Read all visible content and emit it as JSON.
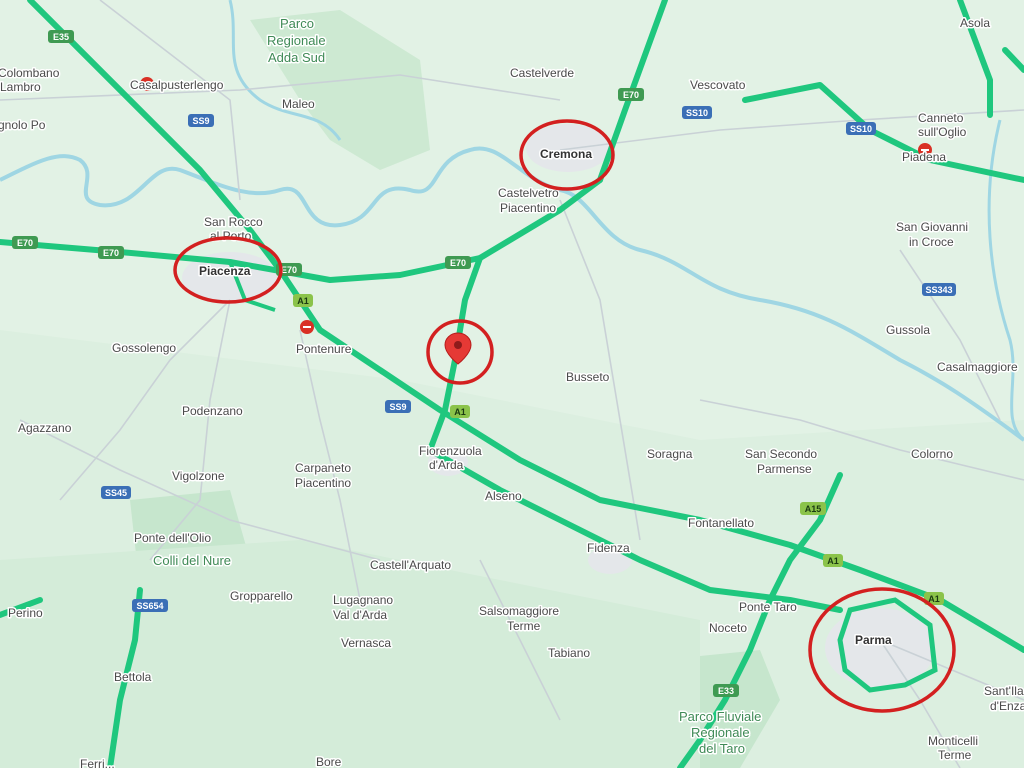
{
  "colors": {
    "land": "#dcefe0",
    "land_light": "#e4f3e7",
    "park": "#c9e8cf",
    "urban": "#e6e9ec",
    "river": "#9fd6e3",
    "traffic_green": "#1fc77e",
    "minor_road": "#c5ccd2",
    "marker_red": "#e53935",
    "circle_red": "#d32020",
    "e_shield": "#3f9a52",
    "a_shield": "#8bc34a",
    "ss_shield": "#3b6fb6"
  },
  "places": {
    "colombano": "Colombano",
    "lambro": "Lambro",
    "gnolo_po": "gnolo Po",
    "casalpusterlengo": "Casalpusterlengo",
    "maleo": "Maleo",
    "parco_adda_1": "Parco",
    "parco_adda_2": "Regionale",
    "parco_adda_3": "Adda Sud",
    "castelverde": "Castelverde",
    "vescovato": "Vescovato",
    "asola": "Asola",
    "canneto_1": "Canneto",
    "canneto_2": "sull'Oglio",
    "piadena": "Piadena",
    "cremona": "Cremona",
    "castelvetro_1": "Castelvetro",
    "castelvetro_2": "Piacentino",
    "san_rocco_1": "San Rocco",
    "san_rocco_2": "al Porto",
    "piacenza": "Piacenza",
    "san_giovanni_1": "San Giovanni",
    "san_giovanni_2": "in Croce",
    "pontenure": "Pontenure",
    "gossolengo": "Gossolengo",
    "busseto": "Busseto",
    "gussola": "Gussola",
    "casalmaggiore": "Casalmaggiore",
    "podenzano": "Podenzano",
    "agazzano": "Agazzano",
    "fiorenzuola_1": "Fiorenzuola",
    "fiorenzuola_2": "d'Arda",
    "soragna": "Soragna",
    "san_secondo_1": "San Secondo",
    "san_secondo_2": "Parmense",
    "colorno": "Colorno",
    "vigolzone": "Vigolzone",
    "carpaneto_1": "Carpaneto",
    "carpaneto_2": "Piacentino",
    "alseno": "Alseno",
    "fontanellato": "Fontanellato",
    "ponte_olio": "Ponte dell'Olio",
    "colli_nure": "Colli del Nure",
    "castellarquato": "Castell'Arquato",
    "fidenza": "Fidenza",
    "perino": "Perino",
    "gropparello": "Gropparello",
    "lugagnano_1": "Lugagnano",
    "lugagnano_2": "Val d'Arda",
    "salsomaggiore_1": "Salsomaggiore",
    "salsomaggiore_2": "Terme",
    "ponte_taro": "Ponte Taro",
    "noceto": "Noceto",
    "parma": "Parma",
    "vernasca": "Vernasca",
    "tabiano": "Tabiano",
    "bettola": "Bettola",
    "santilario_1": "Sant'Ila",
    "santilario_2": "d'Enza",
    "parco_taro_1": "Parco Fluviale",
    "parco_taro_2": "Regionale",
    "parco_taro_3": "del Taro",
    "monticelli_1": "Monticelli",
    "monticelli_2": "Terme",
    "bore": "Bore",
    "ferriere": "Ferri..."
  },
  "shields": {
    "e35": "E35",
    "e70": "E70",
    "a1": "A1",
    "a15": "A15",
    "e33": "E33",
    "ss9": "SS9",
    "ss10": "SS10",
    "ss343": "SS343",
    "ss45": "SS45",
    "ss654": "SS654"
  }
}
